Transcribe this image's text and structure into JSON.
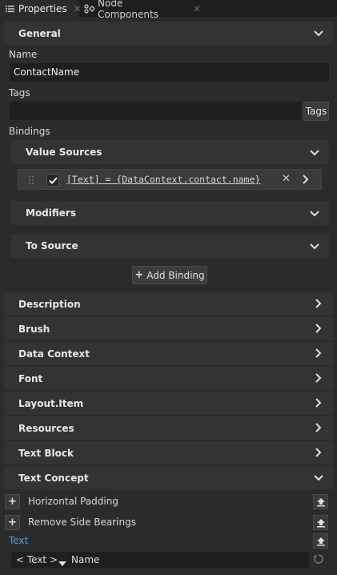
{
  "tabs": [
    {
      "label": "Properties",
      "icon": "list-icon",
      "active": true
    },
    {
      "label": "Node Components",
      "icon": "components-icon",
      "active": false
    }
  ],
  "general": {
    "title": "General",
    "name_label": "Name",
    "name_value": "ContactName",
    "tags_label": "Tags",
    "tags_value": "",
    "tags_button": "Tags",
    "bindings_label": "Bindings",
    "value_sources_title": "Value Sources",
    "binding_expression": "[Text] = {DataContext.contact.name}",
    "modifiers_title": "Modifiers",
    "to_source_title": "To Source",
    "add_binding_label": "Add Binding"
  },
  "sections": [
    "Description",
    "Brush",
    "Data Context",
    "Font",
    "Layout.Item",
    "Resources",
    "Text Block"
  ],
  "text_concept": {
    "title": "Text Concept",
    "props": [
      "Horizontal Padding",
      "Remove Side Bearings"
    ],
    "text_label": "Text",
    "binding_source": "< Text >",
    "binding_value": "Name"
  },
  "colors": {
    "background": "#2b2b2b",
    "section": "#333333",
    "field": "#1f1f1f",
    "accent": "#4a9fe0"
  }
}
